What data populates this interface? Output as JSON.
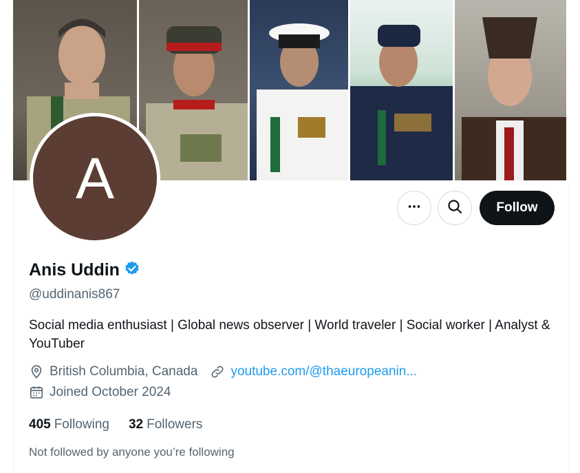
{
  "profile": {
    "name": "Anis Uddin",
    "handle": "@uddinanis867",
    "avatar_letter": "A",
    "avatar_color": "#5c3d33",
    "verified": true,
    "bio": "Social media enthusiast | Global news observer | World traveler | Social worker | Analyst & YouTuber",
    "location": "British Columbia, Canada",
    "website": "youtube.com/@thaeuropeanin...",
    "joined": "Joined October 2024"
  },
  "actions": {
    "follow_label": "Follow",
    "more_icon": "more-icon",
    "search_icon": "search-icon"
  },
  "stats": {
    "following_count": "405",
    "following_label": "Following",
    "followers_count": "32",
    "followers_label": "Followers"
  },
  "notice": "Not followed by anyone you’re following",
  "colors": {
    "verified_badge": "#1d9bf0",
    "link": "#1d9bf0",
    "follow_button": "#0f1419"
  }
}
